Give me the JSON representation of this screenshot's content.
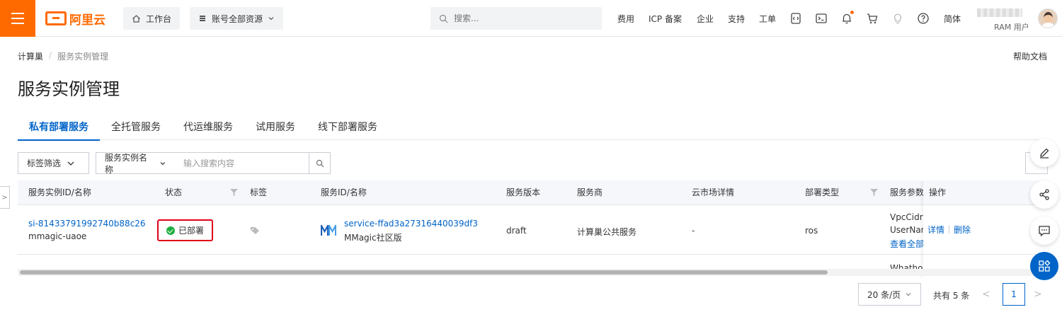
{
  "topbar": {
    "logo_text": "阿里云",
    "workbench": "工作台",
    "resources": "账号全部资源",
    "search_placeholder": "搜索...",
    "nav": [
      "费用",
      "ICP 备案",
      "企业",
      "支持",
      "工单"
    ],
    "lang": "简体",
    "user_role": "RAM 用户",
    "brand_color": "#ff6a00"
  },
  "breadcrumb": {
    "root": "计算巢",
    "current": "服务实例管理"
  },
  "help_link": "帮助文档",
  "page_title": "服务实例管理",
  "tabs": [
    "私有部署服务",
    "全托管服务",
    "代运维服务",
    "试用服务",
    "线下部署服务"
  ],
  "filters": {
    "tag_filter": "标签筛选",
    "field_select": "服务实例名称",
    "search_placeholder": "输入搜索内容"
  },
  "table": {
    "columns": [
      "服务实例ID/名称",
      "状态",
      "标签",
      "服务ID/名称",
      "服务版本",
      "服务商",
      "云市场详情",
      "部署类型",
      "服务参数",
      "操作"
    ],
    "rows": [
      {
        "instance_id": "si-81433791992740b88c26",
        "instance_name": "mmagic-uaoe",
        "status": "已部署",
        "service_id": "service-ffad3a27316440039df3",
        "service_name": "MMagic社区版",
        "version": "draft",
        "provider": "计算巢公共服务",
        "market": "-",
        "deploy_type": "ros",
        "params_line1": "VpcCidrI",
        "params_line2": "UserNan",
        "params_more": "查看全部",
        "action_detail": "详情",
        "action_delete": "删除"
      }
    ],
    "row2_fragment": "Whatho"
  },
  "pagination": {
    "page_size": "20 条/页",
    "total": "共有 5 条",
    "current_page": "1"
  },
  "accent_color": "#0064c8",
  "highlight_color": "#e0001a"
}
